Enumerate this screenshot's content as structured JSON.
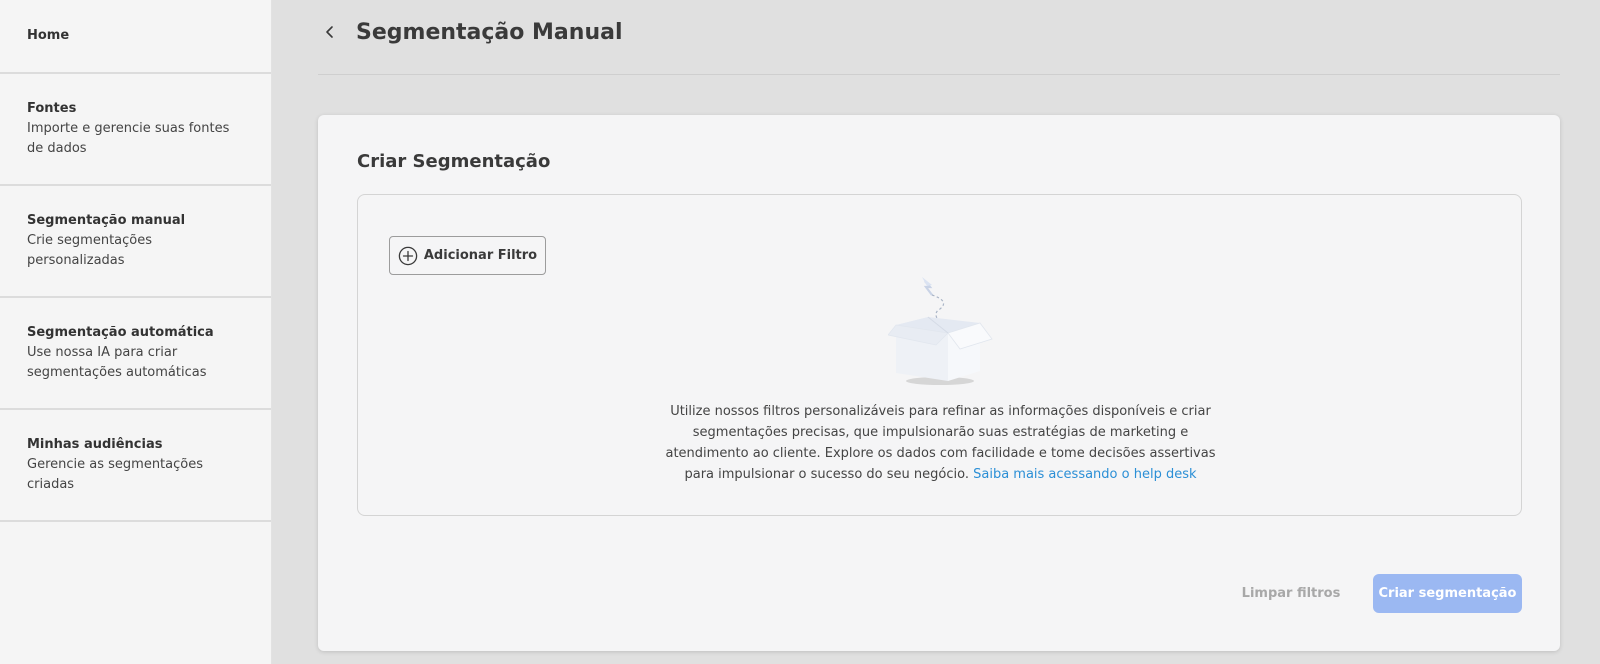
{
  "sidebar": {
    "items": [
      {
        "title": "Home",
        "description": ""
      },
      {
        "title": "Fontes",
        "description": "Importe e gerencie suas fontes de dados"
      },
      {
        "title": "Segmentação manual",
        "description": "Crie segmentações personalizadas"
      },
      {
        "title": "Segmentação automática",
        "description": "Use nossa IA para criar segmentações automáticas"
      },
      {
        "title": "Minhas audiências",
        "description": "Gerencie as segmentações criadas"
      }
    ]
  },
  "header": {
    "back_icon": "chevron-left-icon",
    "title": "Segmentação Manual"
  },
  "card": {
    "title": "Criar Segmentação",
    "add_filter_label": "Adicionar Filtro",
    "add_filter_icon": "plus-circle-icon",
    "empty_icon": "empty-box-icon",
    "empty_text": "Utilize nossos filtros personalizáveis para refinar as informações disponíveis e criar segmentações precisas, que impulsionarão suas estratégias de marketing e atendimento ao cliente. Explore os dados com facilidade e tome decisões assertivas para impulsionar o sucesso do seu negócio.",
    "help_link": "Saiba mais acessando o help desk",
    "clear_label": "Limpar filtros",
    "create_label": "Criar segmentação"
  },
  "colors": {
    "background": "#e0e0e0",
    "sidebar": "#f5f5f5",
    "link": "#2b8fd6",
    "primary_disabled": "#9bb8f2"
  }
}
